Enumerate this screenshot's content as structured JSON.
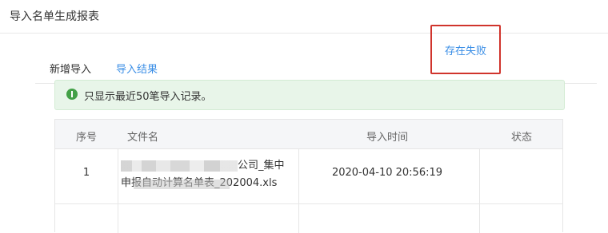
{
  "page": {
    "title": "导入名单生成报表"
  },
  "tabs": [
    {
      "label": "新增导入",
      "active": false
    },
    {
      "label": "导入结果",
      "active": true
    }
  ],
  "alert": {
    "message": "只显示最近50笔导入记录。",
    "icon": "success-info-icon",
    "color": "#43a047"
  },
  "table": {
    "headers": [
      "序号",
      "文件名",
      "导入时间",
      "状态"
    ],
    "rows": [
      {
        "index": "1",
        "filename_line1_suffix": "公司_集中",
        "filename_line2": "申报自动计算名单表_202004.xls",
        "import_time": "2020-04-10 20:56:19",
        "status": "存在失败"
      }
    ]
  },
  "colors": {
    "accent": "#3a8ee6",
    "highlight_border": "#d0342c"
  }
}
